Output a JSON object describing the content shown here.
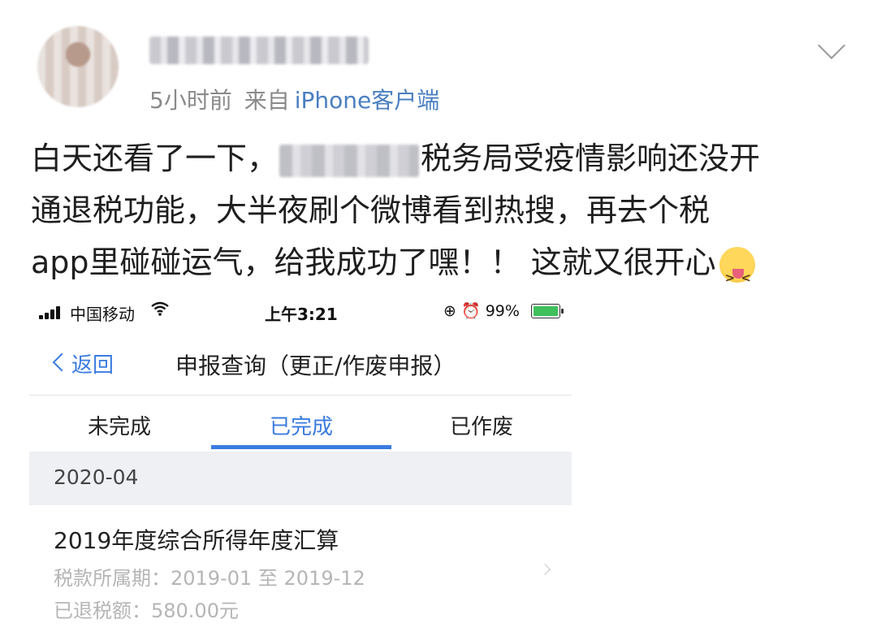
{
  "post": {
    "time": "5小时前",
    "source_prefix": "来自",
    "source": "iPhone客户端",
    "text_line1_before": "白天还看了一下，",
    "text_line1_after": "税务局受疫情影响还没开",
    "text_line2": "通退税功能，大半夜刷个微博看到热搜，再去个税",
    "text_line3": "app里碰碰运气，给我成功了嘿！！ 这就又很开心",
    "emoji_icon": "squinting-tongue-emoji"
  },
  "phone": {
    "status": {
      "carrier": "中国移动",
      "time": "上午3:21",
      "battery": "99%"
    },
    "nav": {
      "back_label": "返回",
      "title": "申报查询（更正/作废申报）"
    },
    "tabs": [
      {
        "label": "未完成"
      },
      {
        "label": "已完成"
      },
      {
        "label": "已作废"
      }
    ],
    "active_tab": 1,
    "section_date": "2020-04",
    "item": {
      "title": "2019年度综合所得年度汇算",
      "period": "税款所属期：2019-01 至 2019-12",
      "refund": "已退税额：580.00元"
    },
    "accent_color": "#3a7be0"
  }
}
